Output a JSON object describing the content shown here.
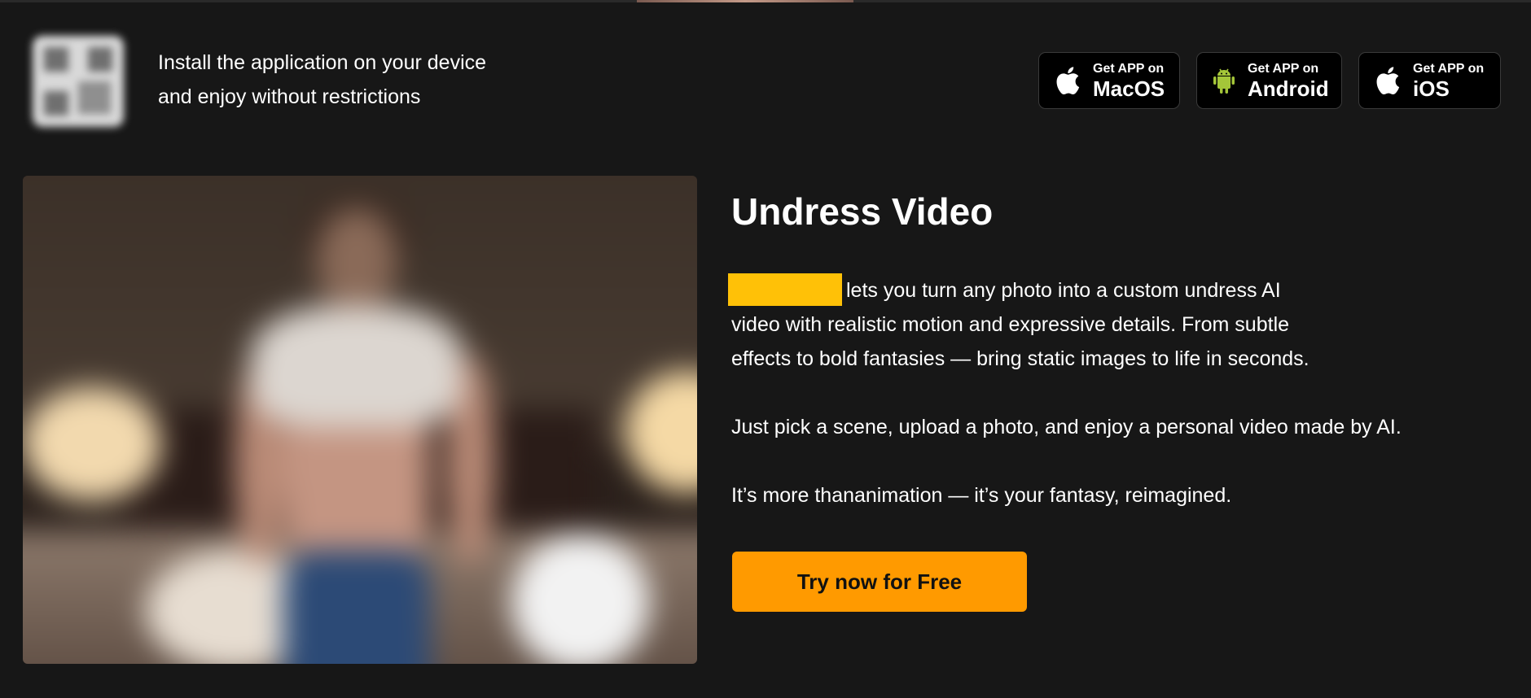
{
  "banner": {
    "install_line_1": "Install the application on your device",
    "install_line_2": "and enjoy without restrictions",
    "qr_icon": "qr-code",
    "stores": [
      {
        "small": "Get APP on",
        "big": "MacOS",
        "icon": "apple-icon"
      },
      {
        "small": "Get APP on",
        "big": "Android",
        "icon": "android-icon",
        "icon_color": "#a4c639"
      },
      {
        "small": "Get APP on",
        "big": "iOS",
        "icon": "apple-icon"
      }
    ]
  },
  "main": {
    "title": "Undress Video",
    "desc1_line1": "lets you turn any photo into a custom undress AI",
    "desc1_line2": "video with realistic motion and expressive details. From subtle",
    "desc1_line3": "effects to bold fantasies — bring static images to life in seconds.",
    "desc2": "Just pick a scene, upload a photo, and enjoy a personal video made by AI.",
    "desc3": "It’s more thananimation — it’s your fantasy, reimagined.",
    "cta_label": "Try now for Free",
    "redaction_color": "#ffc107",
    "cta_color": "#ff9a00"
  }
}
